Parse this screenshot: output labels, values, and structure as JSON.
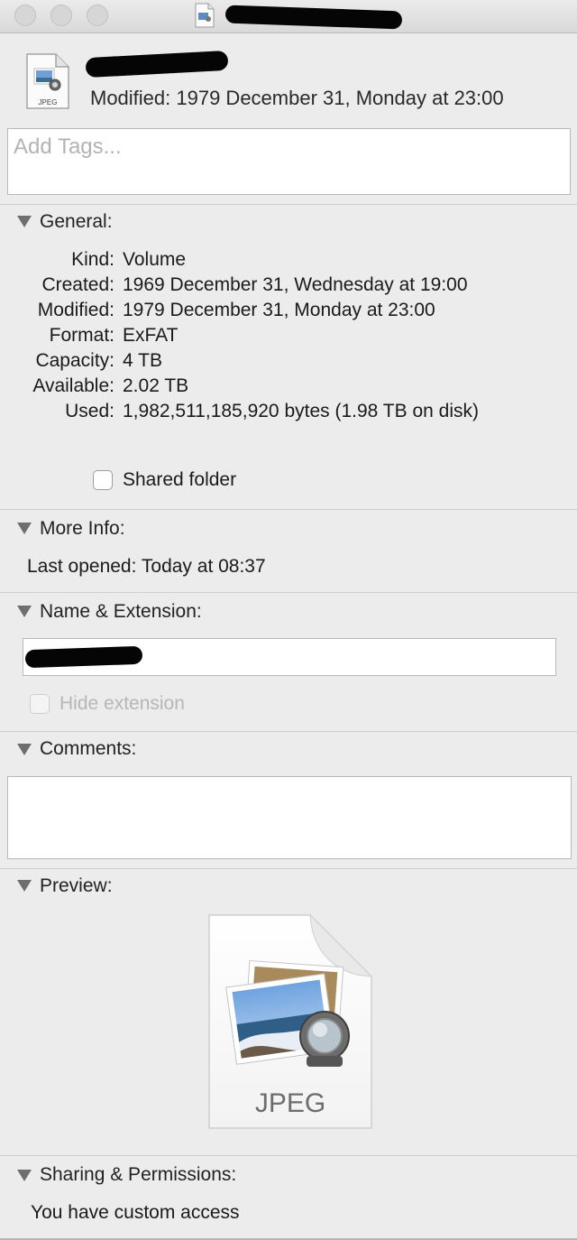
{
  "header": {
    "modified": "Modified: 1979 December 31, Monday at 23:00",
    "tags_placeholder": "Add Tags...",
    "icon_name": "jpeg-file-icon",
    "icon_caption": "JPEG"
  },
  "general": {
    "title": "General:",
    "rows": [
      {
        "label": "Kind:",
        "value": "Volume"
      },
      {
        "label": "Created:",
        "value": "1969 December 31, Wednesday at 19:00"
      },
      {
        "label": "Modified:",
        "value": "1979 December 31, Monday at 23:00"
      },
      {
        "label": "Format:",
        "value": "ExFAT"
      },
      {
        "label": "Capacity:",
        "value": "4 TB"
      },
      {
        "label": "Available:",
        "value": "2.02 TB"
      },
      {
        "label": "Used:",
        "value": "1,982,511,185,920 bytes (1.98 TB on disk)"
      }
    ],
    "shared_folder_label": "Shared folder",
    "shared_folder_checked": false
  },
  "more_info": {
    "title": "More Info:",
    "last_opened": "Last opened:  Today at 08:37"
  },
  "name_extension": {
    "title": "Name & Extension:",
    "hide_extension_label": "Hide extension",
    "hide_extension_checked": false
  },
  "comments": {
    "title": "Comments:"
  },
  "preview": {
    "title": "Preview:",
    "file_type_label": "JPEG"
  },
  "sharing": {
    "title": "Sharing & Permissions:",
    "access_text": "You have custom access"
  }
}
